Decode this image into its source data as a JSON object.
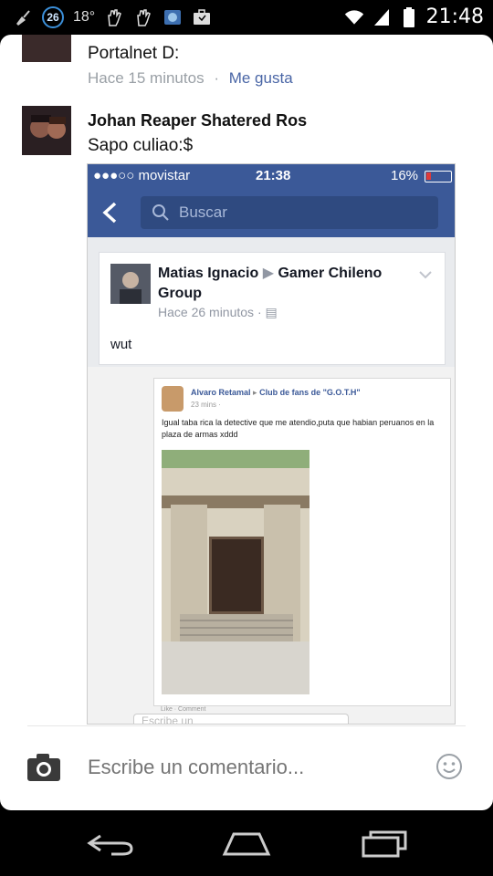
{
  "status_bar": {
    "notification_count": "26",
    "temperature": "18°",
    "time": "21:48",
    "icons": [
      "notification-icon",
      "hand-icon",
      "hand-icon",
      "globe-icon",
      "briefcase-icon",
      "wifi-icon",
      "signal-icon",
      "battery-icon"
    ]
  },
  "comments": [
    {
      "author": "Portalnet D:",
      "time": "Hace 15 minutos",
      "separator": "·",
      "like": "Me gusta"
    },
    {
      "author": "Johan Reaper Shatered Ros",
      "text": "Sapo culiao:$"
    }
  ],
  "embedded": {
    "carrier": "●●●○○ movistar",
    "time": "21:38",
    "battery": "16%",
    "battery_level": 0.16,
    "search_placeholder": "Buscar",
    "post": {
      "author": "Matias Ignacio",
      "arrow": "▶",
      "group": "Gamer Chileno Group",
      "time": "Hace 26 minutos ·",
      "body": "wut"
    },
    "inner_post": {
      "author": "Alvaro Retamal",
      "arrow": "▸",
      "group": "Club de fans de \"G.O.T.H\"",
      "time": "23 mins ·",
      "text": "Igual taba rica la detective que me atendio,puta que habian peruanos en la plaza de armas xddd",
      "footer": "Like · Comment",
      "comment_placeholder": "Escribe un"
    }
  },
  "composer": {
    "placeholder": "Escribe un comentario..."
  }
}
